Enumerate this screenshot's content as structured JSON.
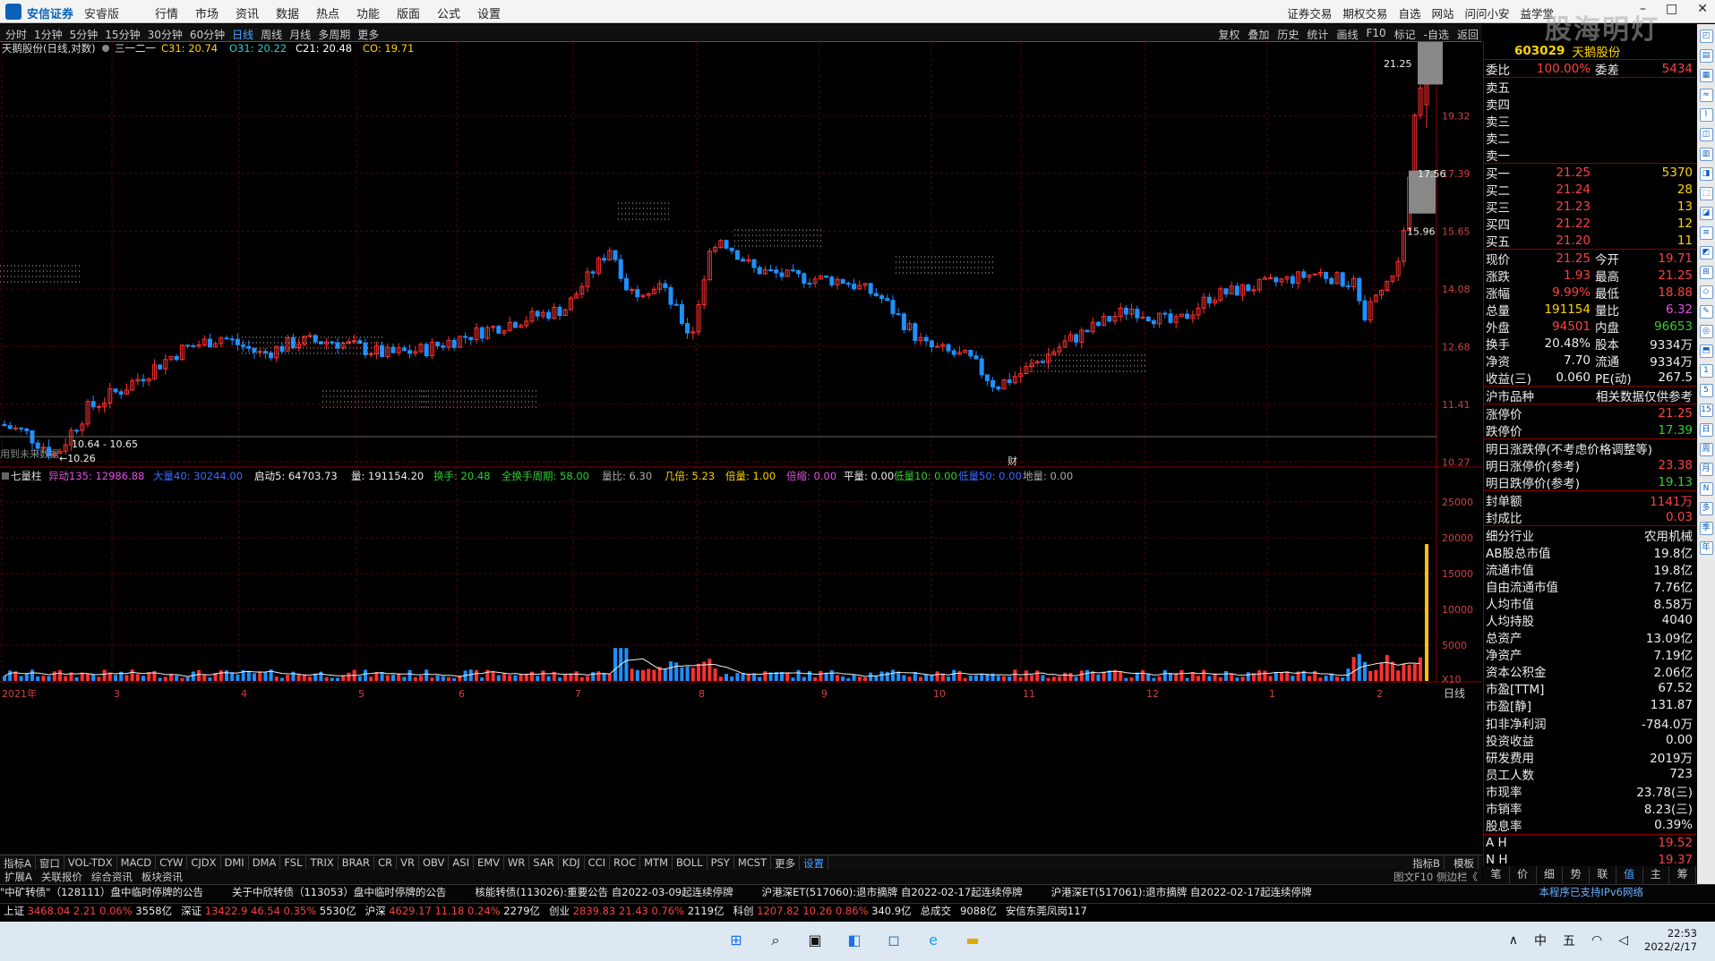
{
  "app": {
    "brand": "安信证券",
    "edition": "安睿版",
    "menus": [
      "行情",
      "市场",
      "资讯",
      "数据",
      "热点",
      "功能",
      "版面",
      "公式",
      "设置"
    ],
    "right_menus": [
      "证券交易",
      "期权交易",
      "自选",
      "网站",
      "问问小安",
      "益学堂"
    ],
    "watermark": "股海明灯"
  },
  "periods": {
    "items": [
      "分时",
      "1分钟",
      "5分钟",
      "15分钟",
      "30分钟",
      "60分钟",
      "日线",
      "周线",
      "月线",
      "多周期",
      "更多"
    ],
    "active": "日线",
    "right": [
      "复权",
      "叠加",
      "历史",
      "统计",
      "画线",
      "F10",
      "标记",
      "-自选",
      "返回"
    ]
  },
  "chart_header": {
    "title": "天鹅股份(日线,对数)",
    "pattern": "三一二一",
    "c31": "C31: 20.74",
    "o31": "O31: 20.22",
    "c21": "C21: 20.48",
    "co": "CO: 19.71"
  },
  "price_axis": [
    "19.32",
    "17.39",
    "15.65",
    "14.08",
    "12.68",
    "11.41",
    "10.27"
  ],
  "volume_axis": [
    "25000",
    "20000",
    "15000",
    "10000",
    "5000",
    "X10"
  ],
  "annotations": {
    "high": "21.25",
    "low": "←10.26",
    "low_range": "10.64 - 10.65",
    "future": "用到未来数据",
    "g1": "17.56",
    "g2": "15.96",
    "cai": "财"
  },
  "volume_header": {
    "title": "七量柱",
    "yidong": "异动135: 12986.88",
    "fuliang": "大量40: 30244.00",
    "qidong": "启动5: 64703.73",
    "liang": "量: 191154.20",
    "huanshou": "换手: 20.48",
    "zhouqi": "全换手周期: 58.00",
    "liangbi": "量比: 6.30",
    "jibei": "几倍: 5.23",
    "beiliang": "倍量: 1.00",
    "beisuo": "倍缩: 0.00",
    "pingliang": "平量: 0.00",
    "diliang": "低量10: 0.00",
    "gaoliang": "低量50: 0.00",
    "diliang2": "地量: 0.00"
  },
  "x_axis": {
    "year": "2021年",
    "months": [
      "3",
      "4",
      "5",
      "6",
      "7",
      "8",
      "9",
      "10",
      "11",
      "12",
      "1",
      "2"
    ],
    "right": "日线"
  },
  "indicators": [
    "指标A",
    "窗口",
    "VOL-TDX",
    "MACD",
    "CYW",
    "CJDX",
    "DMI",
    "DMA",
    "FSL",
    "TRIX",
    "BRAR",
    "CR",
    "VR",
    "OBV",
    "ASI",
    "EMV",
    "WR",
    "SAR",
    "KDJ",
    "CCI",
    "ROC",
    "MTM",
    "BOLL",
    "PSY",
    "MCST",
    "更多",
    "设置"
  ],
  "indicators_right": [
    "指标B",
    "模板"
  ],
  "tabs": [
    "扩展A",
    "关联报价",
    "综合资讯",
    "板块资讯"
  ],
  "tabs_right": "图文F10  侧边栏《",
  "ticker": [
    "\"中矿转债\"（128111）盘中临时停牌的公告",
    "关于中欣转债（113053）盘中临时停牌的公告",
    "核能转债(113026):重要公告 自2022-03-09起连续停牌",
    "沪港深ET(517060):退市摘牌 自2022-02-17起连续停牌",
    "沪港深ET(517061):退市摘牌 自2022-02-17起连续停牌"
  ],
  "ticker_right": "本程序已支持IPv6网络",
  "indices": [
    {
      "name": "上证",
      "value": "3468.04",
      "chg": "2.21",
      "pct": "0.06%",
      "amt": "3558亿"
    },
    {
      "name": "深证",
      "value": "13422.9",
      "chg": "46.54",
      "pct": "0.35%",
      "amt": "5530亿"
    },
    {
      "name": "沪深",
      "value": "4629.17",
      "chg": "11.18",
      "pct": "0.24%",
      "amt": "2279亿"
    },
    {
      "name": "创业",
      "value": "2839.83",
      "chg": "21.43",
      "pct": "0.76%",
      "amt": "2119亿"
    },
    {
      "name": "科创",
      "value": "1207.82",
      "chg": "10.26",
      "pct": "0.86%",
      "amt": "340.9亿"
    }
  ],
  "totals": {
    "label": "总成交",
    "value": "9088亿",
    "broker": "安信东莞凤岗117"
  },
  "quote": {
    "code": "603029",
    "name": "天鹅股份",
    "weibi": {
      "label": "委比",
      "value": "100.00%",
      "label2": "委差",
      "value2": "5434"
    },
    "sell": [
      {
        "label": "卖五",
        "price": "",
        "vol": ""
      },
      {
        "label": "卖四",
        "price": "",
        "vol": ""
      },
      {
        "label": "卖三",
        "price": "",
        "vol": ""
      },
      {
        "label": "卖二",
        "price": "",
        "vol": ""
      },
      {
        "label": "卖一",
        "price": "",
        "vol": ""
      }
    ],
    "buy": [
      {
        "label": "买一",
        "price": "21.25",
        "vol": "5370"
      },
      {
        "label": "买二",
        "price": "21.24",
        "vol": "28"
      },
      {
        "label": "买三",
        "price": "21.23",
        "vol": "13"
      },
      {
        "label": "买四",
        "price": "21.22",
        "vol": "12"
      },
      {
        "label": "买五",
        "price": "21.20",
        "vol": "11"
      }
    ],
    "stats": [
      {
        "l1": "现价",
        "v1": "21.25",
        "l2": "今开",
        "v2": "19.71",
        "c1": "red",
        "c2": "red"
      },
      {
        "l1": "涨跌",
        "v1": "1.93",
        "l2": "最高",
        "v2": "21.25",
        "c1": "red",
        "c2": "red"
      },
      {
        "l1": "涨幅",
        "v1": "9.99%",
        "l2": "最低",
        "v2": "18.88",
        "c1": "red",
        "c2": "red"
      },
      {
        "l1": "总量",
        "v1": "191154",
        "l2": "量比",
        "v2": "6.32",
        "c1": "yel",
        "c2": "mag"
      },
      {
        "l1": "外盘",
        "v1": "94501",
        "l2": "内盘",
        "v2": "96653",
        "c1": "red",
        "c2": "green"
      },
      {
        "l1": "换手",
        "v1": "20.48%",
        "l2": "股本",
        "v2": "9334万",
        "c1": "wht",
        "c2": "wht"
      },
      {
        "l1": "净资",
        "v1": "7.70",
        "l2": "流通",
        "v2": "9334万",
        "c1": "wht",
        "c2": "wht"
      },
      {
        "l1": "收益(三)",
        "v1": "0.060",
        "l2": "PE(动)",
        "v2": "267.5",
        "c1": "wht",
        "c2": "wht"
      }
    ],
    "market": {
      "l": "沪市品种",
      "r": "相关数据仅供参考"
    },
    "limits": [
      {
        "l": "涨停价",
        "v": "21.25",
        "c": "red"
      },
      {
        "l": "跌停价",
        "v": "17.39",
        "c": "green"
      }
    ],
    "nextday": {
      "title": "明日涨跌停(不考虑价格调整等)",
      "up_l": "明日涨停价(参考)",
      "up_v": "23.38",
      "dn_l": "明日跌停价(参考)",
      "dn_v": "19.13"
    },
    "seal": [
      {
        "l": "封单额",
        "v": "1141万",
        "c": "red"
      },
      {
        "l": "封成比",
        "v": "0.03",
        "c": "red"
      }
    ],
    "fund": [
      {
        "l": "细分行业",
        "v": "农用机械"
      },
      {
        "l": "AB股总市值",
        "v": "19.8亿"
      },
      {
        "l": "流通市值",
        "v": "19.8亿"
      },
      {
        "l": "自由流通市值",
        "v": "7.76亿"
      },
      {
        "l": "人均市值",
        "v": "8.58万"
      },
      {
        "l": "人均持股",
        "v": "4040"
      },
      {
        "l": "总资产",
        "v": "13.09亿"
      },
      {
        "l": "净资产",
        "v": "7.19亿"
      },
      {
        "l": "资本公积金",
        "v": "2.06亿"
      },
      {
        "l": "市盈[TTM]",
        "v": "67.52"
      },
      {
        "l": "市盈[静]",
        "v": "131.87"
      },
      {
        "l": "扣非净利润",
        "v": "-784.0万"
      },
      {
        "l": "投资收益",
        "v": "0.00"
      },
      {
        "l": "研发费用",
        "v": "2019万"
      },
      {
        "l": "员工人数",
        "v": "723"
      },
      {
        "l": "市现率",
        "v": "23.78(三)"
      },
      {
        "l": "市销率",
        "v": "8.23(三)"
      },
      {
        "l": "股息率",
        "v": "0.39%"
      }
    ],
    "ah": [
      {
        "l": "A H",
        "v": "19.52"
      },
      {
        "l": "N H",
        "v": "19.37"
      }
    ],
    "tabs": [
      "笔",
      "价",
      "细",
      "势",
      "联",
      "值",
      "主",
      "筹"
    ],
    "tab_active": "值"
  },
  "taskbar": {
    "ime": "中",
    "ime2": "五",
    "time": "22:53",
    "date": "2022/2/17"
  },
  "colors": {
    "up": "#ff3030",
    "down": "#1e90ff",
    "bg": "#000000",
    "grid": "#5a0000",
    "axis": "#8b0000"
  },
  "chart_data": {
    "type": "candlestick",
    "series_name": "天鹅股份 日线",
    "price_range": [
      10.26,
      21.25
    ],
    "scale": "log",
    "last": {
      "open": 19.71,
      "high": 21.25,
      "low": 18.88,
      "close": 21.25
    },
    "volume_last": 191154
  }
}
